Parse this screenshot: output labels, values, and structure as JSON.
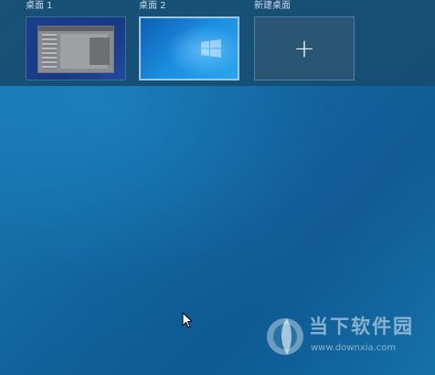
{
  "task_view": {
    "desktops": [
      {
        "label": "桌面 1"
      },
      {
        "label": "桌面 2"
      }
    ],
    "new_desktop": {
      "label": "新建桌面",
      "icon": "plus-icon",
      "symbol": "+"
    }
  },
  "cursor": {
    "icon": "mouse-pointer-icon"
  },
  "watermark": {
    "title": "当下软件园",
    "url": "www.downxia.com",
    "icon": "downxia-logo-icon"
  },
  "colors": {
    "topbar": "#174e70",
    "selected_border": "#9cc6e6",
    "desktop_background": "#13659f"
  }
}
